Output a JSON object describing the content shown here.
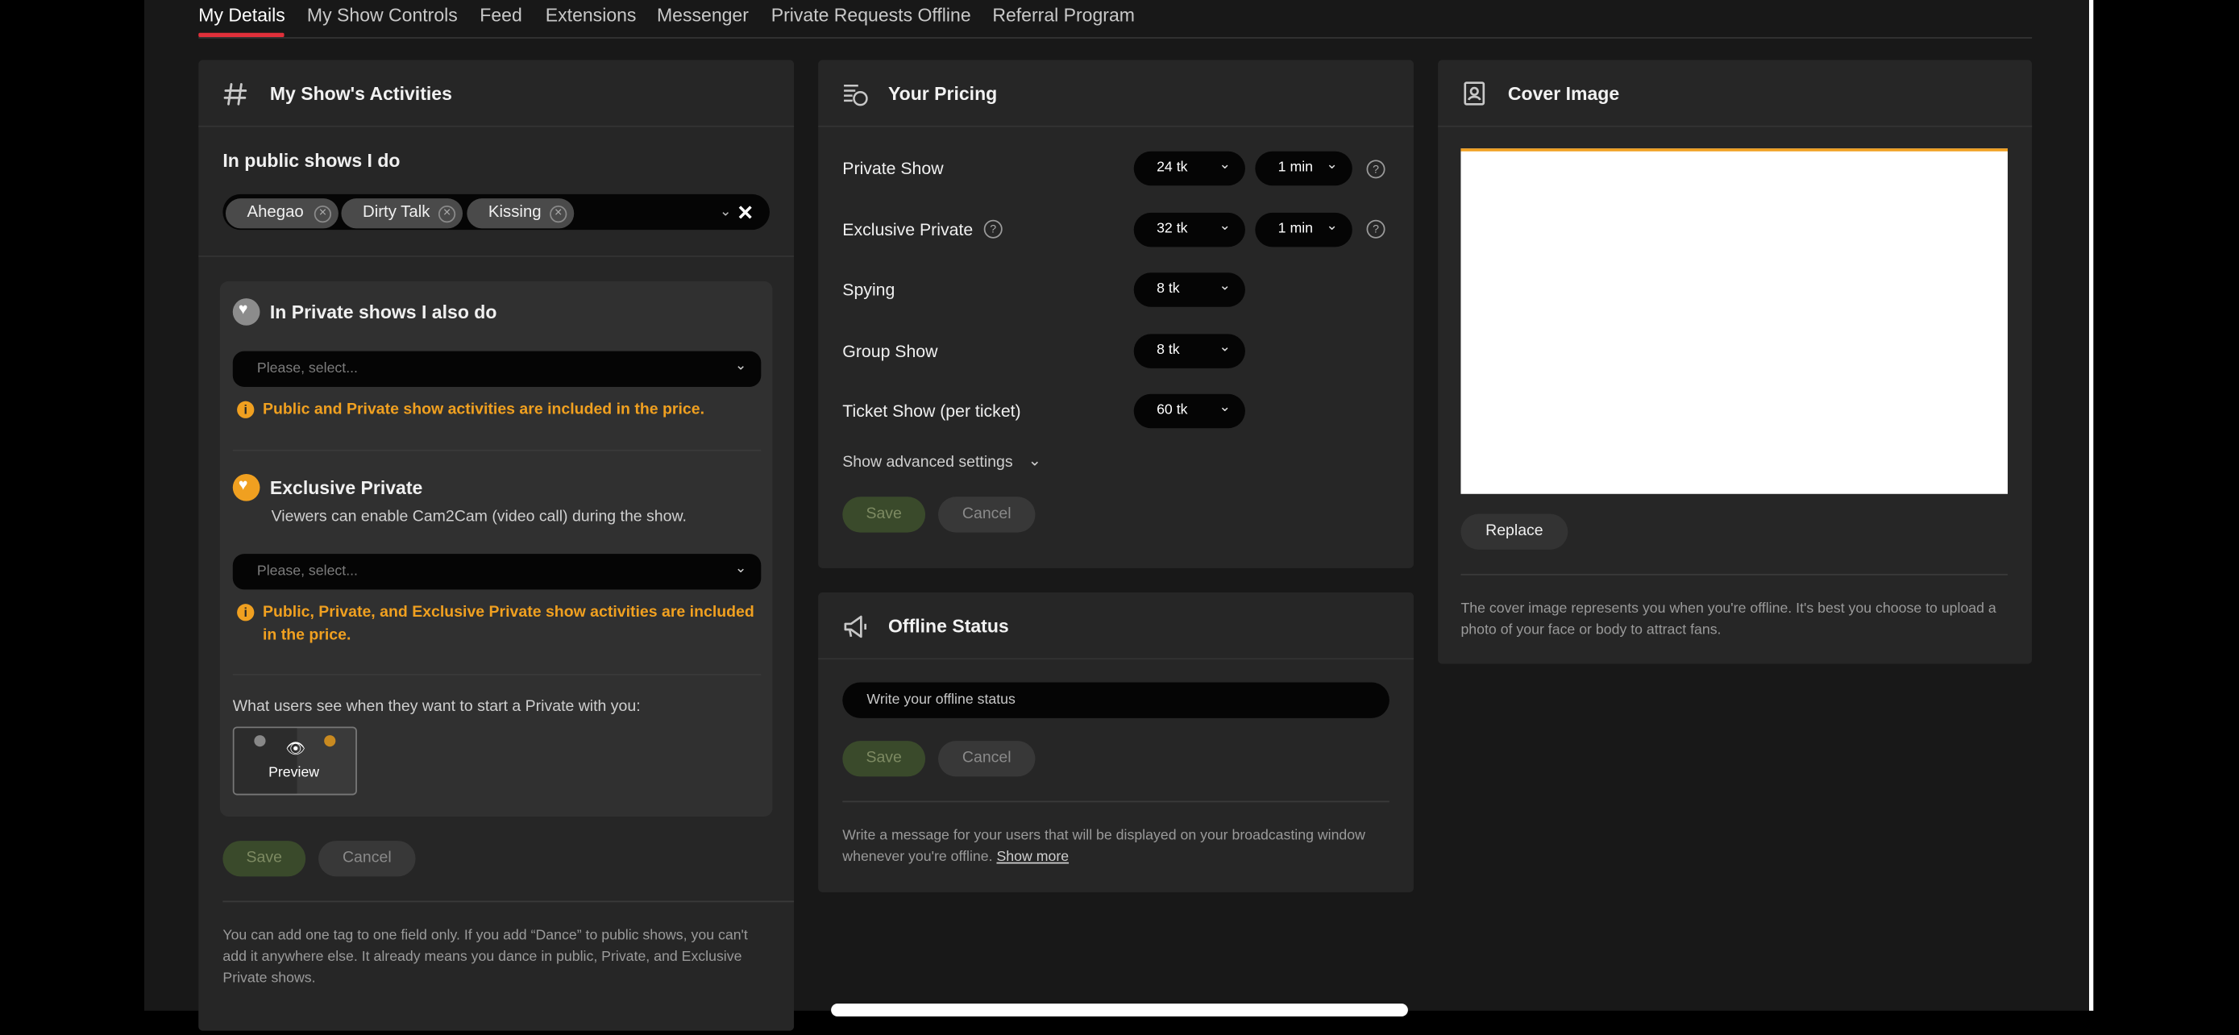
{
  "tabs": [
    {
      "label": "My Details"
    },
    {
      "label": "My Show Controls"
    },
    {
      "label": "Feed"
    },
    {
      "label": "Extensions"
    },
    {
      "label": "Messenger"
    },
    {
      "label": "Private Requests Offline"
    },
    {
      "label": "Referral Program"
    }
  ],
  "activities": {
    "title": "My Show's Activities",
    "public_heading": "In public shows I do",
    "public_tags": [
      "Ahegao",
      "Dirty Talk",
      "Kissing"
    ],
    "private_heading": "In Private shows I also do",
    "private_placeholder": "Please, select...",
    "private_note": "Public and Private show activities are included in the price.",
    "exclusive_heading": "Exclusive Private",
    "exclusive_sub": "Viewers can enable Cam2Cam (video call) during the show.",
    "exclusive_placeholder": "Please, select...",
    "exclusive_note": "Public, Private, and Exclusive Private show activities are included in the price.",
    "preview_caption": "What users see when they want to start a Private with you:",
    "preview_label": "Preview",
    "save_label": "Save",
    "cancel_label": "Cancel",
    "footer_note": "You can add one tag to one field only. If you add “Dance” to public shows, you can't add it anywhere else. It already means you dance in public, Private, and Exclusive Private shows."
  },
  "pricing": {
    "title": "Your Pricing",
    "rows": [
      {
        "label": "Private Show",
        "price": "24 tk",
        "duration": "1 min"
      },
      {
        "label": "Exclusive Private",
        "price": "32 tk",
        "duration": "1 min"
      },
      {
        "label": "Spying",
        "price": "8 tk"
      },
      {
        "label": "Group Show",
        "price": "8 tk"
      },
      {
        "label": "Ticket Show (per ticket)",
        "price": "60 tk"
      }
    ],
    "advanced_label": "Show advanced settings",
    "save_label": "Save",
    "cancel_label": "Cancel"
  },
  "offline": {
    "title": "Offline Status",
    "placeholder": "Write your offline status",
    "save_label": "Save",
    "cancel_label": "Cancel",
    "note": "Write a message for your users that will be displayed on your broadcasting window whenever you're offline.",
    "show_more": "Show more"
  },
  "cover": {
    "title": "Cover Image",
    "replace_label": "Replace",
    "note": "The cover image represents you when you're offline. It's best you choose to upload a photo of your face or body to attract fans."
  },
  "colors": {
    "accent_red": "#e0303a",
    "warning_orange": "#f0a020",
    "panel_bg": "#262626",
    "save_green": "#3a4a2b"
  }
}
